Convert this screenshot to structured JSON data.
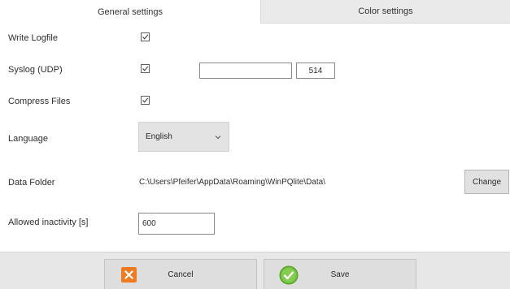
{
  "tabs": {
    "general": "General settings",
    "color": "Color settings"
  },
  "settings": {
    "write_logfile": {
      "label": "Write Logfile",
      "checked": true
    },
    "syslog": {
      "label": "Syslog (UDP)",
      "checked": true,
      "host": "",
      "port": "514"
    },
    "compress_files": {
      "label": "Compress Files",
      "checked": true
    },
    "language": {
      "label": "Language",
      "value": "English"
    },
    "data_folder": {
      "label": "Data Folder",
      "path": "C:\\Users\\Pfeifer\\AppData\\Roaming\\WinPQlite\\Data\\",
      "change_label": "Change"
    },
    "allowed_inactivity": {
      "label": "Allowed inactivity [s]",
      "value": "600"
    }
  },
  "footer": {
    "cancel_label": "Cancel",
    "save_label": "Save"
  },
  "colors": {
    "cancel_icon": "#f07a20",
    "save_icon": "#6dbb3a",
    "tab_inactive": "#eaeaea",
    "footer_bg": "#e7e7e7"
  },
  "icons": {
    "checkbox": "check-icon",
    "dropdown": "chevron-down-icon",
    "cancel": "close-icon",
    "save": "checkmark-circle-icon"
  }
}
